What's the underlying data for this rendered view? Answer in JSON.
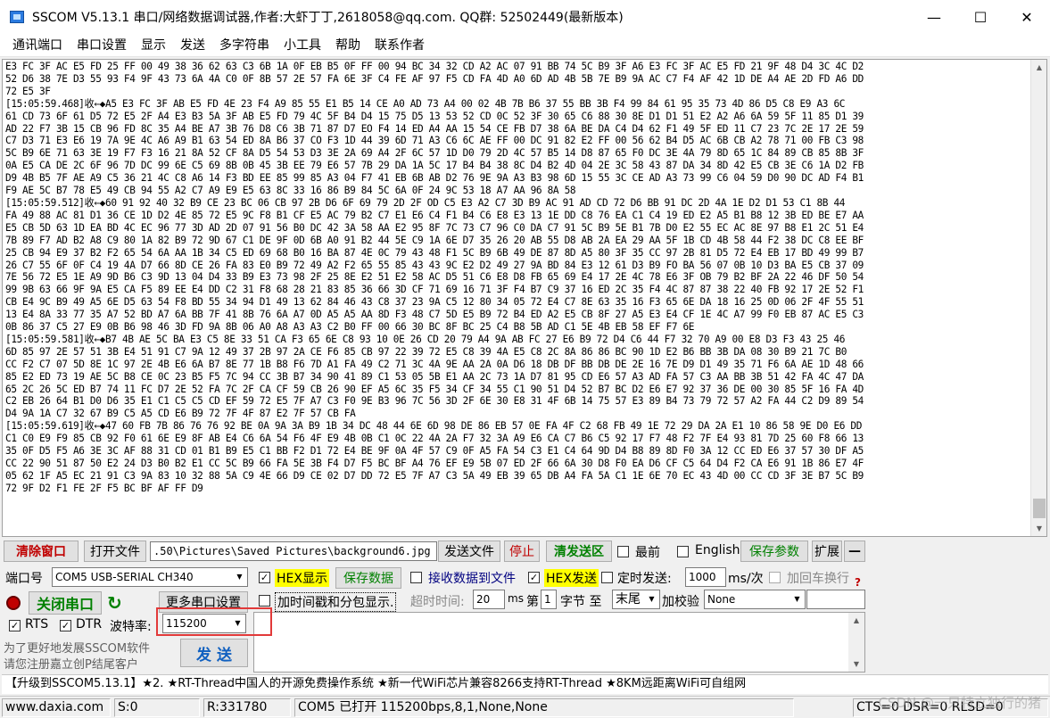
{
  "window": {
    "title": "SSCOM V5.13.1 串口/网络数据调试器,作者:大虾丁丁,2618058@qq.com. QQ群: 52502449(最新版本)",
    "minimize": "—",
    "maximize": "☐",
    "close": "✕"
  },
  "menu": [
    "通讯端口",
    "串口设置",
    "显示",
    "发送",
    "多字符串",
    "小工具",
    "帮助",
    "联系作者"
  ],
  "output_lines": [
    "E3 FC 3F AC E5 FD 25 FF 00 49 38 36 62 63 C3 6B 1A 0F EB B5 0F FF 00 94 BC 34 32 CD A2 AC 07 91 BB 74 5C B9 3F A6 E3 FC 3F AC E5 FD 21 9F 48 D4 3C 4C D2",
    "52 D6 38 7E D3 55 93 F4 9F 43 73 6A 4A C0 0F 8B 57 2E 57 FA 6E 3F C4 FE AF 97 F5 CD FA 4D A0 6D AD 4B 5B 7E B9 9A AC C7 F4 AF 42 1D DE A4 AE 2D FD A6 DD",
    "72 E5 3F",
    "[15:05:59.468]收←◆A5 E3 FC 3F AB E5 FD 4E 23 F4 A9 85 55 E1 B5 14 CE A0 AD 73 A4 00 02 4B 7B B6 37 55 BB 3B F4 99 84 61 95 35 73 4D 86 D5 C8 E9 A3 6C",
    "61 CD 73 6F 61 D5 72 E5 2F A4 E3 B3 5A 3F AB E5 FD 79 4C 5F B4 D4 15 75 D5 13 53 52 CD 0C 52 3F 30 65 C6 88 30 8E D1 D1 51 E2 A2 A6 6A 59 5F 11 85 D1 39",
    "AD 22 F7 3B 15 CB 96 FD 8C 35 A4 BE A7 3B 76 D8 C6 3B 71 87 D7 EO F4 14 ED A4 AA 15 54 CE FB D7 38 6A BE DA C4 D4 62 F1 49 5F ED 11 C7 23 7C 2E 17 2E 59",
    "C7 D3 71 E3 E6 19 7A 9E 4C A6 A9 B1 63 54 ED 8A B6 37 CO F3 1D 44 39 6D 71 A3 C6 6C AE FF 00 DC 91 82 E2 FF 00 56 62 B4 D5 AC 6B CB A2 78 71 00 FB C3 98",
    "5C B9 6E 71 63 3E 19 F7 F3 16 21 8A 52 CF 8A D5 54 53 D3 3E 2A 69 A4 2F 6C 57 1D D0 79 2D 4C 57 B5 14 D8 87 65 F0 DC 3E 4A 79 8D 65 1C 84 89 CB 85 8B 3F",
    "0A E5 CA DE 2C 6F 96 7D DC 99 6E C5 69 8B 0B 45 3B EE 79 E6 57 7B 29 DA 1A 5C 17 B4 B4 38 8C D4 B2 4D 04 2E 3C 58 43 87 DA 34 8D 42 E5 CB 3E C6 1A D2 FB",
    "D9 4B B5 7F AE A9 C5 36 21 4C C8 A6 14 F3 BD EE 85 99 85 A3 04 F7 41 EB 6B AB D2 76 9E 9A A3 B3 98 6D 15 55 3C CE AD A3 73 99 C6 04 59 D0 90 DC AD F4 B1",
    "F9 AE 5C B7 78 E5 49 CB 94 55 A2 C7 A9 E9 E5 63 8C 33 16 86 B9 84 5C 6A 0F 24 9C 53 18 A7 AA 96 8A 58",
    "[15:05:59.512]收←◆60 91 92 40 32 B9 CE 23 BC 06 CB 97 2B D6 6F 69 79 2D 2F OD C5 E3 A2 C7 3D B9 AC 91 AD CD 72 D6 BB 91 DC 2D 4A 1E D2 D1 53 C1 8B 44",
    "FA 49 88 AC 81 D1 36 CE 1D D2 4E 85 72 E5 9C F8 B1 CF E5 AC 79 B2 C7 E1 E6 C4 F1 B4 C6 E8 E3 13 1E DD C8 76 EA C1 C4 19 ED E2 A5 B1 B8 12 3B ED BE E7 AA",
    "E5 CB 5D 63 1D EA BD 4C EC 96 77 3D AD 2D 07 91 56 B0 DC 42 3A 58 AA E2 95 8F 7C 73 C7 96 C0 DA C7 91 5C B9 5E B1 7B D0 E2 55 EC AC 8E 97 B8 E1 2C 51 E4",
    "7B 89 F7 AD B2 A8 C9 80 1A 82 B9 72 9D 67 C1 DE 9F 0D 6B A0 91 B2 44 5E C9 1A 6E D7 35 26 20 AB 55 D8 AB 2A EA 29 AA 5F 1B CD 4B 58 44 F2 38 DC C8 EE BF",
    "25 CB 94 E9 37 B2 F2 65 54 6A AA 1B 34 C5 ED 69 68 B0 16 BA 87 4E 0C 79 43 48 F1 5C B9 6B 49 DE 87 8D A5 80 3F 35 CC 97 2B 81 D5 72 E4 EB 17 BD 49 99 B7",
    "26 C7 55 6F 0F C4 19 4A D7 66 8D CE 26 FA 83 E0 B9 72 49 A2 F2 65 55 85 43 43 9C E2 D2 49 27 9A BD 84 E3 12 61 D3 B9 FO BA 56 07 0B 10 D3 BA E5 CB 37 09",
    "7E 56 72 E5 1E A9 9D B6 C3 9D 13 04 D4 33 B9 E3 73 98 2F 25 8E E2 51 E2 58 AC D5 51 C6 E8 D8 FB 65 69 E4 17 2E 4C 78 E6 3F OB 79 B2 BF 2A 22 46 DF 50 54",
    "99 9B 63 66 9F 9A E5 CA F5 89 EE E4 DD C2 31 F8 68 28 21 83 85 36 66 3D CF 71 69 16 71 3F F4 B7 C9 37 16 ED 2C 35 F4 4C 87 87 38 22 40 FB 92 17 2E 52 F1",
    "CB E4 9C B9 49 A5 6E D5 63 54 F8 BD 55 34 94 D1 49 13 62 84 46 43 C8 37 23 9A C5 12 80 34 05 72 E4 C7 8E 63 35 16 F3 65 6E DA 18 16 25 0D 06 2F 4F 55 51",
    "13 E4 8A 33 77 35 A7 52 BD A7 6A BB 7F 41 8B 76 6A A7 0D A5 A5 AA 8D F3 48 C7 5D E5 B9 72 B4 ED A2 E5 CB 8F 27 A5 E3 E4 CF 1E 4C A7 99 F0 EB 87 AC E5 C3",
    "0B 86 37 C5 27 E9 0B B6 98 46 3D FD 9A 8B 06 A0 A8 A3 A3 C2 B0 FF 00 66 30 BC 8F BC 25 C4 B8 5B AD C1 5E 4B EB 58 EF F7 6E",
    "[15:05:59.581]收←◆B7 4B AE 5C BA E3 C5 8E 33 51 CA F3 65 6E C8 93 10 0E 26 CD 20 79 A4 9A AB FC 27 E6 B9 72 D4 C6 44 F7 32 70 A9 00 E8 D3 F3 43 25 46",
    "6D 85 97 2E 57 51 3B E4 51 91 C7 9A 12 49 37 2B 97 2A CE F6 85 CB 97 22 39 72 E5 C8 39 4A E5 C8 2C 8A 86 86 BC 90 1D E2 B6 BB 3B DA 08 30 B9 21 7C B0",
    "CC F2 C7 07 5D 8E 1C 97 2E 4B E6 6A B7 8E 77 1B B8 F6 7D A1 FA 49 C2 71 3C 4A 9E AA 2A 0A D6 18 DB DF BB DB DE 2E 16 7E D9 D1 49 35 71 F6 6A AE 1D 48 66",
    "85 E2 ED 73 19 AE 5C B8 CE 0C 23 B5 F5 7C 94 CC 3B B7 34 90 41 89 C1 53 05 5B E1 AA 2C 73 1A D7 81 95 CD E6 57 A3 AD FA 57 C3 AA BB 3B 51 42 FA 4C 47 DA",
    "65 2C 26 5C ED B7 74 11 FC D7 2E 52 FA 7C 2F CA CF 59 CB 26 90 EF A5 6C 35 F5 34 CF 34 55 C1 90 51 D4 52 B7 BC D2 E6 E7 92 37 36 DE 00 30 85 5F 16 FA 4D",
    "C2 EB 26 64 B1 D0 D6 35 E1 C1 C5 C5 CD EF 59 72 E5 7F A7 C3 F0 9E B3 96 7C 56 3D 2F 6E 30 E8 31 4F 6B 14 75 57 E3 89 B4 73 79 72 57 A2 FA 44 C2 D9 89 54",
    "D4 9A 1A C7 32 67 B9 C5 A5 CD E6 B9 72 7F 4F 87 E2 7F 57 CB FA",
    "[15:05:59.619]收←◆47 60 FB 7B 86 76 76 92 BE 0A 9A 3A B9 1B 34 DC 48 44 6E 6D 98 DE 86 EB 57 0E FA 4F C2 68 FB 49 1E 72 29 DA 2A E1 10 86 58 9E D0 E6 DD",
    "C1 C0 E9 F9 85 CB 92 F0 61 6E E9 8F AB E4 C6 6A 54 F6 4F E9 4B 0B C1 0C 22 4A 2A F7 32 3A A9 E6 CA C7 B6 C5 92 17 F7 48 F2 7F E4 93 81 7D 25 60 F8 66 13",
    "35 0F D5 F5 A6 3E 3C AF 88 31 CD 01 B1 B9 E5 C1 BB F2 D1 72 E4 BE 9F 0A 4F 57 C9 0F A5 FA 54 C3 E1 C4 64 9D D4 B8 89 8D F0 3A 12 CC ED E6 37 57 30 DF A5",
    "CC 22 90 51 87 50 E2 24 D3 B0 B2 E1 CC 5C B9 66 FA 5E 3B F4 D7 F5 BC BF A4 76 EF E9 5B 07 ED 2F 66 6A 30 D8 F0 EA D6 CF C5 64 D4 F2 CA E6 91 1B 86 E7 4F",
    "05 62 1F A5 EC 21 91 C3 9A 83 10 32 88 5A C9 4E 66 D9 CE 02 D7 DD 72 E5 7F A7 C3 5A 49 EB 39 65 DB A4 FA 5A C1 1E 6E 70 EC 43 4D 00 CC CD 3F 3E B7 5C B9",
    "72 9F D2 F1 FE 2F F5 BC BF AF FF D9"
  ],
  "toolbar": {
    "clear_window": "清除窗口",
    "open_file": "打开文件",
    "file_path": ".50\\Pictures\\Saved Pictures\\background6.jpg",
    "send_file": "发送文件",
    "stop": "停止",
    "clear_send": "清发送区",
    "top_most": "最前",
    "english": "English",
    "save_params": "保存参数",
    "expand": "扩展",
    "collapse": "—"
  },
  "port": {
    "label": "端口号",
    "value": "COM5 USB-SERIAL CH340",
    "close_button": "关闭串口",
    "more_settings": "更多串口设置",
    "rts": "RTS",
    "dtr": "DTR",
    "baud_label": "波特率:",
    "baud_value": "115200",
    "promo_line1": "为了更好地发展SSCOM软件",
    "promo_line2": "请您注册嘉立创P结尾客户"
  },
  "options": {
    "hex_display": "HEX显示",
    "save_data": "保存数据",
    "recv_to_file": "接收数据到文件",
    "hex_send": "HEX发送",
    "timed_send": "定时发送:",
    "interval": "1000",
    "interval_unit": "ms/次",
    "add_crlf": "加回车换行",
    "timestamp": "加时间戳和分包显示.",
    "timeout_label": "超时时间:",
    "timeout_value": "20",
    "timeout_unit": "ms",
    "nth_label": "第",
    "nth_value": "1",
    "byte_label": "字节 至",
    "end_value": "末尾",
    "checksum_label": "加校验",
    "checksum_value": "None",
    "help_mark": "?"
  },
  "send": {
    "button": "发 送"
  },
  "marquee": "【升级到SSCOM5.13.1】★2. ★RT-Thread中国人的开源免费操作系统 ★新一代WiFi芯片兼容8266支持RT-Thread ★8KM远距离WiFi可自组网",
  "status": {
    "site": "www.daxia.com",
    "sent": "S:0",
    "received": "R:331780",
    "port_status": "COM5 已打开  115200bps,8,1,None,None",
    "lines": "CTS=0 DSR=0 RLSD=0"
  },
  "watermark": "CSDN @一只特立独行的猪"
}
